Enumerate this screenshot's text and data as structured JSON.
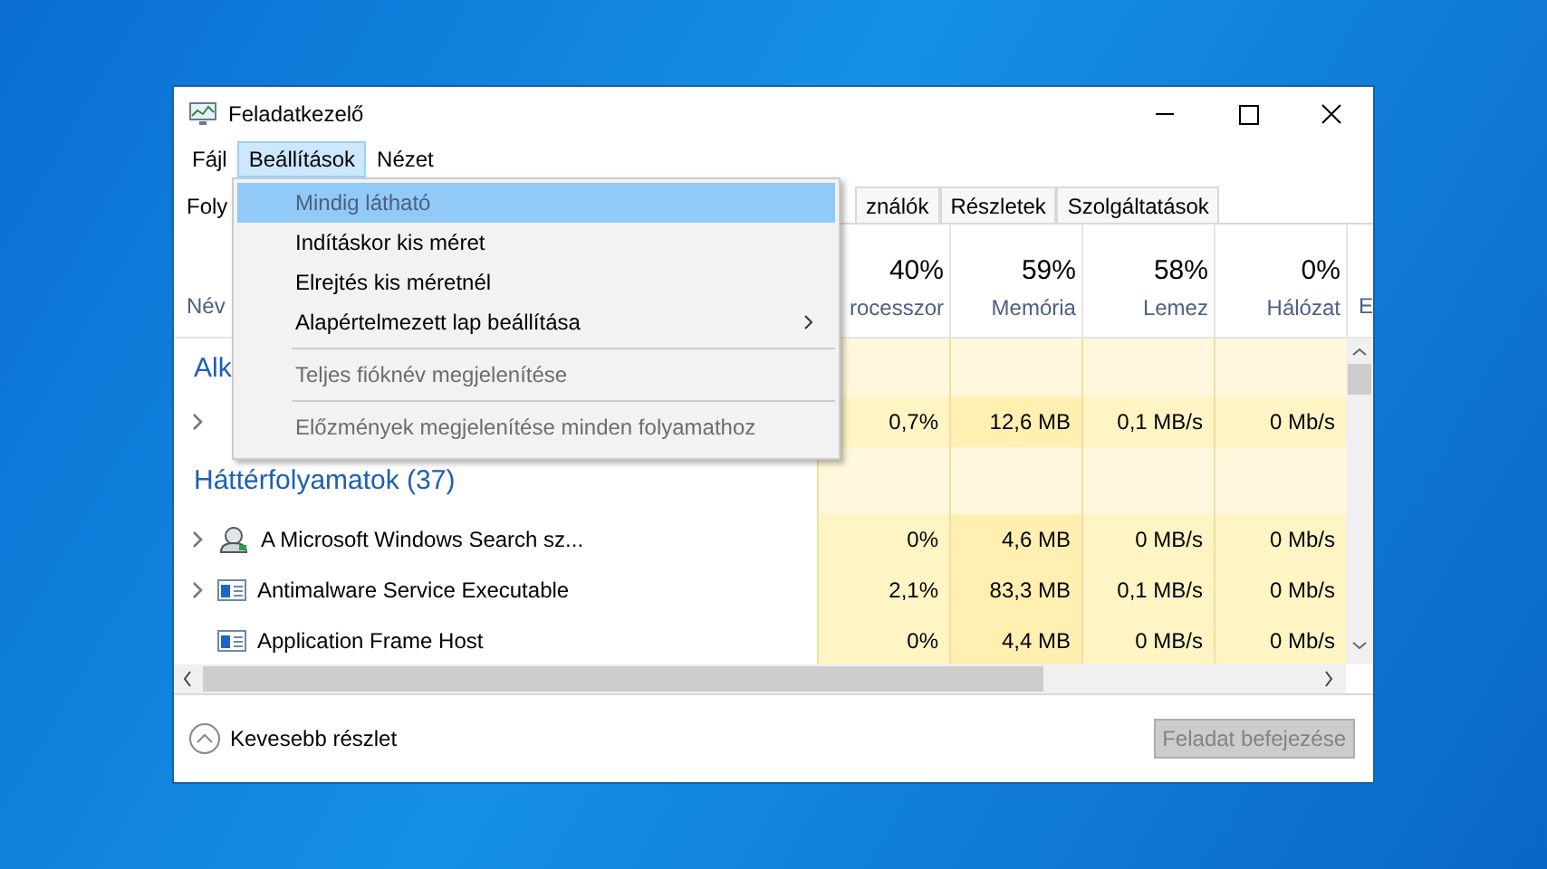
{
  "window": {
    "title": "Feladatkezelő"
  },
  "menu_bar": [
    {
      "label": "Fájl",
      "selected": false
    },
    {
      "label": "Beállítások",
      "selected": true
    },
    {
      "label": "Nézet",
      "selected": false
    }
  ],
  "tabs": [
    {
      "label": "Foly",
      "selected": true
    },
    {
      "label": "ználók",
      "selected": false
    },
    {
      "label": "Részletek",
      "selected": false
    },
    {
      "label": "Szolgáltatások",
      "selected": false
    }
  ],
  "columns": [
    {
      "label": "Név"
    },
    {
      "percent": "40%",
      "label": "rocesszor"
    },
    {
      "percent": "59%",
      "label": "Memória"
    },
    {
      "percent": "58%",
      "label": "Lemez"
    },
    {
      "percent": "0%",
      "label": "Hálózat"
    },
    {
      "label": "E"
    }
  ],
  "groups": [
    {
      "title": "Alk",
      "rows": [
        {
          "expandable": true,
          "values": [
            "0,7%",
            "12,6 MB",
            "0,1 MB/s",
            "0 Mb/s"
          ]
        }
      ]
    },
    {
      "title": "Háttérfolyamatok (37)",
      "rows": [
        {
          "expandable": true,
          "kind": "service",
          "name": "A Microsoft Windows Search sz...",
          "values": [
            "0%",
            "4,6 MB",
            "0 MB/s",
            "0 Mb/s"
          ]
        },
        {
          "expandable": true,
          "kind": "app",
          "name": "Antimalware Service Executable",
          "values": [
            "2,1%",
            "83,3 MB",
            "0,1 MB/s",
            "0 Mb/s"
          ]
        },
        {
          "expandable": false,
          "kind": "app",
          "name": "Application Frame Host",
          "values": [
            "0%",
            "4,4 MB",
            "0 MB/s",
            "0 Mb/s"
          ]
        }
      ]
    }
  ],
  "dropdown": [
    {
      "kind": "item",
      "label": "Mindig látható",
      "selected": true,
      "disabled": false,
      "submenu": false
    },
    {
      "kind": "item",
      "label": "Indításkor kis méret",
      "selected": false,
      "disabled": false,
      "submenu": false
    },
    {
      "kind": "item",
      "label": "Elrejtés kis méretnél",
      "selected": false,
      "disabled": false,
      "submenu": false
    },
    {
      "kind": "item",
      "label": "Alapértelmezett lap beállítása",
      "selected": false,
      "disabled": false,
      "submenu": true
    },
    {
      "kind": "separator"
    },
    {
      "kind": "item",
      "label": "Teljes fióknév megjelenítése",
      "selected": false,
      "disabled": true,
      "submenu": false
    },
    {
      "kind": "separator"
    },
    {
      "kind": "item",
      "label": "Előzmények megjelenítése minden folyamathoz",
      "selected": false,
      "disabled": true,
      "submenu": false
    }
  ],
  "footer": {
    "toggle": "Kevesebb részlet",
    "end_task": {
      "label": "Feladat befejezése",
      "disabled": true
    }
  }
}
